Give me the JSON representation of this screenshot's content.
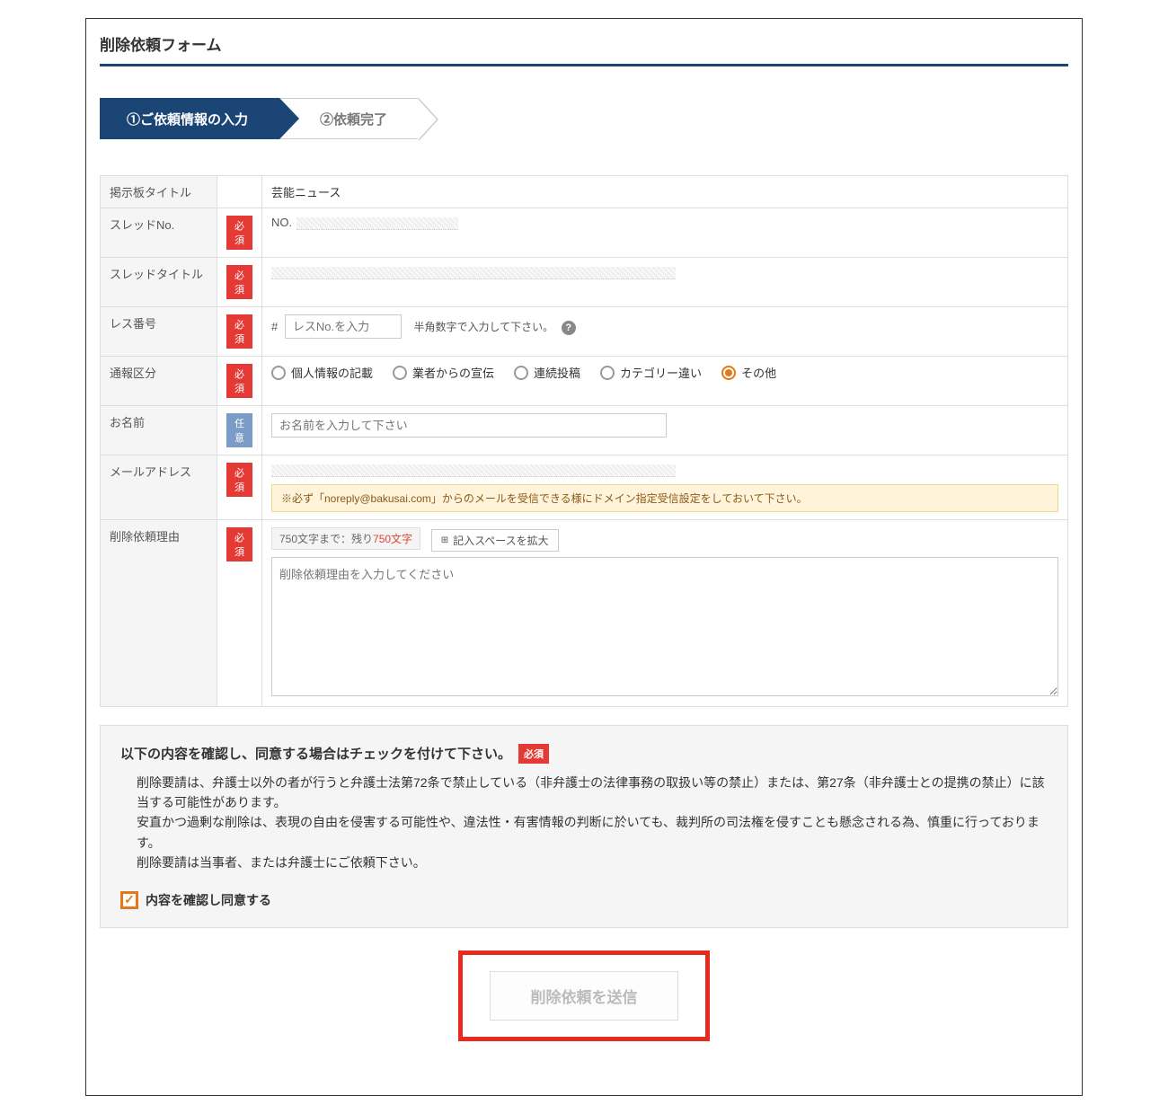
{
  "title": "削除依頼フォーム",
  "steps": {
    "step1": "①ご依頼情報の入力",
    "step2": "②依頼完了"
  },
  "badges": {
    "required": "必須",
    "optional": "任意"
  },
  "fields": {
    "board_title": {
      "label": "掲示板タイトル",
      "value": "芸能ニュース"
    },
    "thread_no": {
      "label": "スレッドNo.",
      "prefix": "NO."
    },
    "thread_title": {
      "label": "スレッドタイトル"
    },
    "res_no": {
      "label": "レス番号",
      "hash": "#",
      "placeholder": "レスNo.を入力",
      "hint": "半角数字で入力して下さい。"
    },
    "report_type": {
      "label": "通報区分",
      "options": [
        "個人情報の記載",
        "業者からの宣伝",
        "連続投稿",
        "カテゴリー違い",
        "その他"
      ],
      "selected_index": 4
    },
    "name": {
      "label": "お名前",
      "placeholder": "お名前を入力して下さい"
    },
    "email": {
      "label": "メールアドレス",
      "notice": "※必ず「noreply@bakusai.com」からのメールを受信できる様にドメイン指定受信設定をしておいて下さい。"
    },
    "reason": {
      "label": "削除依頼理由",
      "counter_prefix": "750文字まで：残り",
      "counter_count": "750文字",
      "expand": "記入スペースを拡大",
      "placeholder": "削除依頼理由を入力してください"
    }
  },
  "consent": {
    "heading": "以下の内容を確認し、同意する場合はチェックを付けて下さい。",
    "text": "削除要請は、弁護士以外の者が行うと弁護士法第72条で禁止している（非弁護士の法律事務の取扱い等の禁止）または、第27条（非弁護士との提携の禁止）に該当する可能性があります。\n安直かつ過剰な削除は、表現の自由を侵害する可能性や、違法性・有害情報の判断に於いても、裁判所の司法権を侵すことも懸念される為、慎重に行っております。\n削除要請は当事者、または弁護士にご依頼下さい。",
    "check_label": "内容を確認し同意する"
  },
  "submit": "削除依頼を送信"
}
